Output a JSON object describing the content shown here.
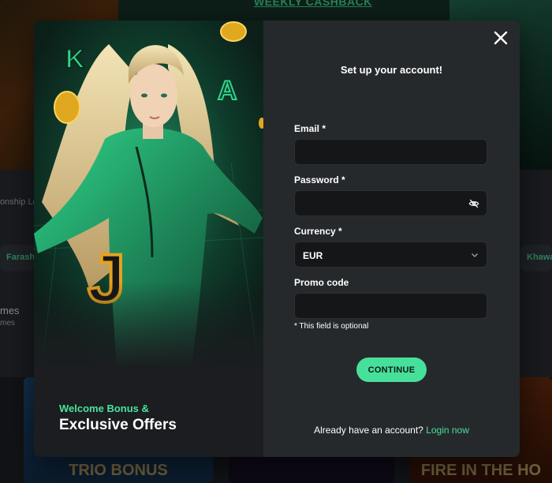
{
  "background": {
    "banner_text": "WEEKLY CASHBACK",
    "chip_left": "Farash",
    "chip_right": "Khawa",
    "side_text_top": "onship Le",
    "side_text_games": "mes",
    "side_text_games_sub": "mes",
    "card_left_label": "TRIO BONUS",
    "card_right_label": "FIRE IN THE HO"
  },
  "promo": {
    "subtitle": "Welcome Bonus &",
    "title": "Exclusive Offers"
  },
  "form": {
    "title": "Set up your account!",
    "email_label": "Email *",
    "email_value": "",
    "password_label": "Password *",
    "password_value": "",
    "currency_label": "Currency *",
    "currency_value": "EUR",
    "promo_label": "Promo code",
    "promo_value": "",
    "optional_hint": "* This field is optional",
    "continue_label": "CONTINUE",
    "login_prompt": "Already have an account?",
    "login_link": "Login now"
  },
  "colors": {
    "accent": "#46e09a",
    "panel": "#26292c",
    "field_bg": "#141618"
  },
  "icons": [
    "close-icon",
    "eye-off-icon",
    "chevron-down-icon"
  ]
}
